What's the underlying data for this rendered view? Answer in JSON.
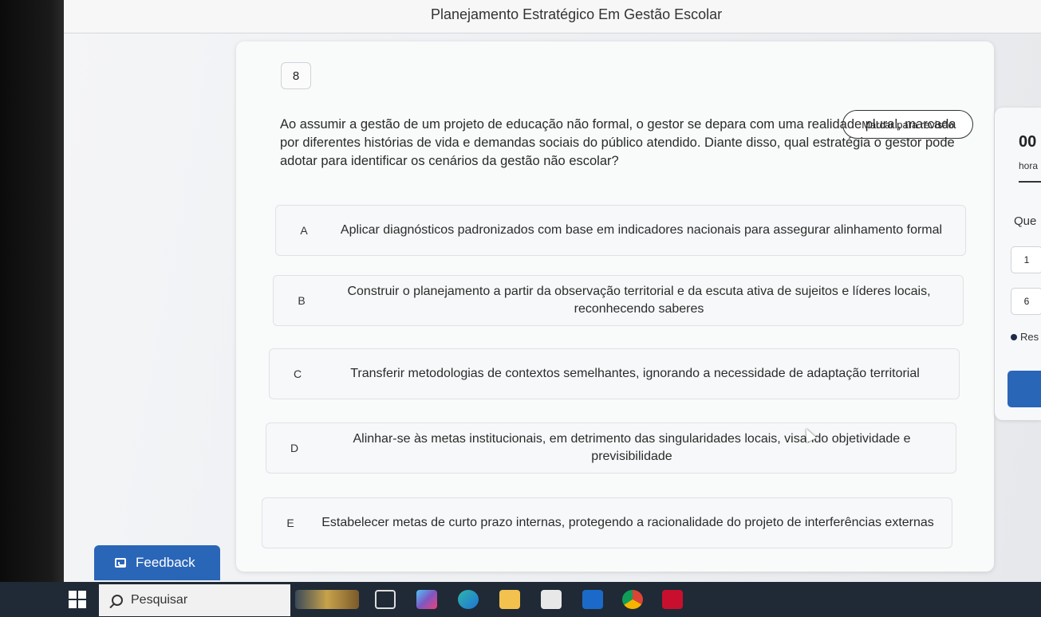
{
  "page": {
    "title": "Planejamento Estratégico Em Gestão Escolar"
  },
  "question": {
    "number": "8",
    "review_label": "Marcar para revisão",
    "text": "Ao assumir a gestão de um projeto de educação não formal, o gestor se depara com uma realidade plural, marcada por diferentes histórias de vida e demandas sociais do público atendido. Diante disso, qual estratégia o gestor pode adotar para identificar os cenários da gestão não escolar?",
    "options": [
      {
        "letter": "A",
        "text": "Aplicar diagnósticos padronizados com base em indicadores nacionais para assegurar alinhamento formal"
      },
      {
        "letter": "B",
        "text": "Construir o planejamento a partir da observação territorial e da escuta ativa de sujeitos e líderes locais, reconhecendo saberes"
      },
      {
        "letter": "C",
        "text": "Transferir metodologias de contextos semelhantes, ignorando a necessidade de adaptação territorial"
      },
      {
        "letter": "D",
        "text": "Alinhar-se às metas institucionais, em detrimento das singularidades locais, visando objetividade e previsibilidade"
      },
      {
        "letter": "E",
        "text": "Estabelecer metas de curto prazo internas, protegendo a racionalidade do projeto de interferências externas"
      }
    ]
  },
  "side_panel": {
    "timer": "00",
    "timer_unit": "hora",
    "questions_label": "Que",
    "nav": [
      "1",
      "6"
    ],
    "answered_label": "Res"
  },
  "feedback": {
    "label": "Feedback"
  },
  "taskbar": {
    "search_placeholder": "Pesquisar",
    "icons": [
      "task-view-icon",
      "copilot-icon",
      "edge-icon",
      "file-explorer-icon",
      "store-icon",
      "outlook-icon",
      "chrome-icon",
      "mcafee-icon"
    ]
  },
  "colors": {
    "accent": "#2a66b8",
    "taskbar": "#1f2a36"
  }
}
